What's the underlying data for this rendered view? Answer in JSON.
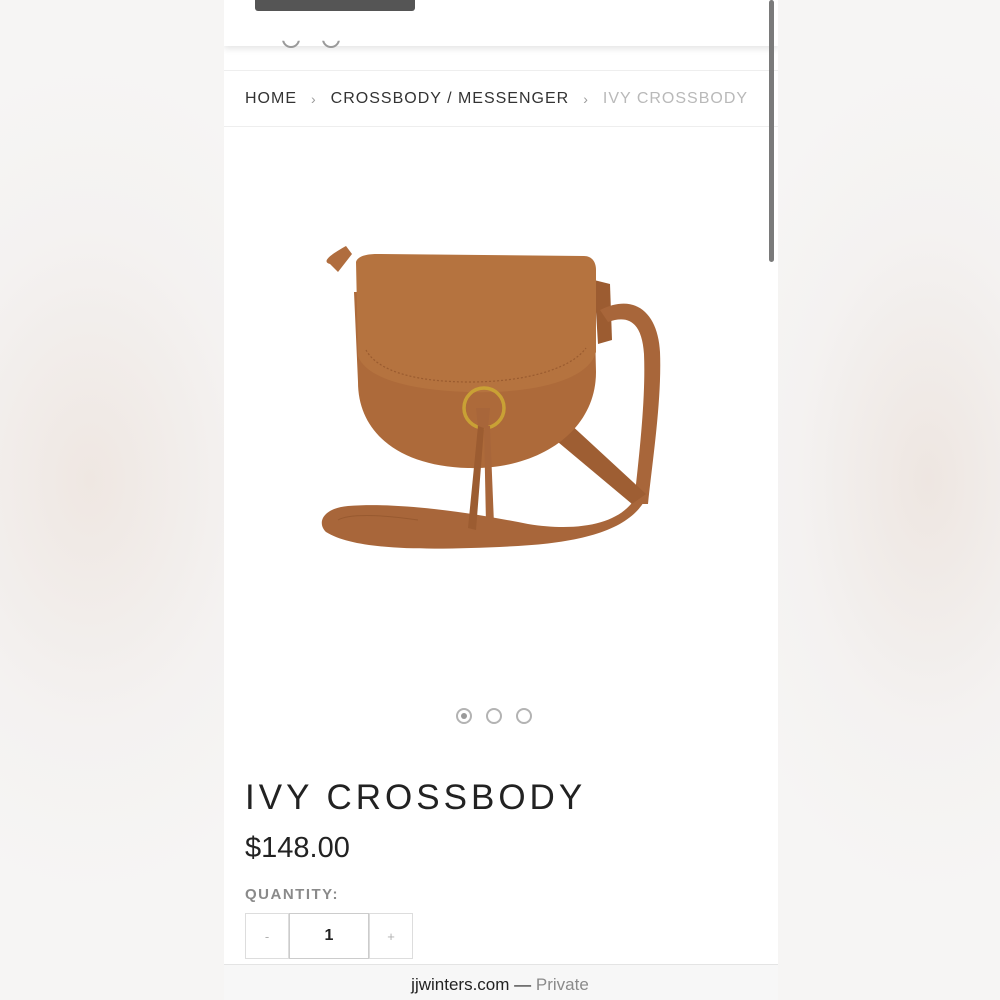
{
  "browser": {
    "domain": "jjwinters.com",
    "separator": "—",
    "privacy_label": "Private"
  },
  "breadcrumb": {
    "home": "HOME",
    "category": "CROSSBODY / MESSENGER",
    "current": "IVY CROSSBODY",
    "separator": "›"
  },
  "product": {
    "image_alt": "brown leather saddle crossbody bag",
    "title": "IVY CROSSBODY",
    "price": "$148.00",
    "carousel": {
      "count": 3,
      "active_index": 0
    }
  },
  "quantity": {
    "label": "QUANTITY:",
    "decrement_label": "-",
    "increment_label": "+",
    "value": "1"
  },
  "colors": {
    "bag_body": "#ad6a3a",
    "bag_strap": "#a8663a",
    "ring": "#c9a135",
    "text_dark": "#222222",
    "breadcrumb_current": "#b9b9b9"
  }
}
